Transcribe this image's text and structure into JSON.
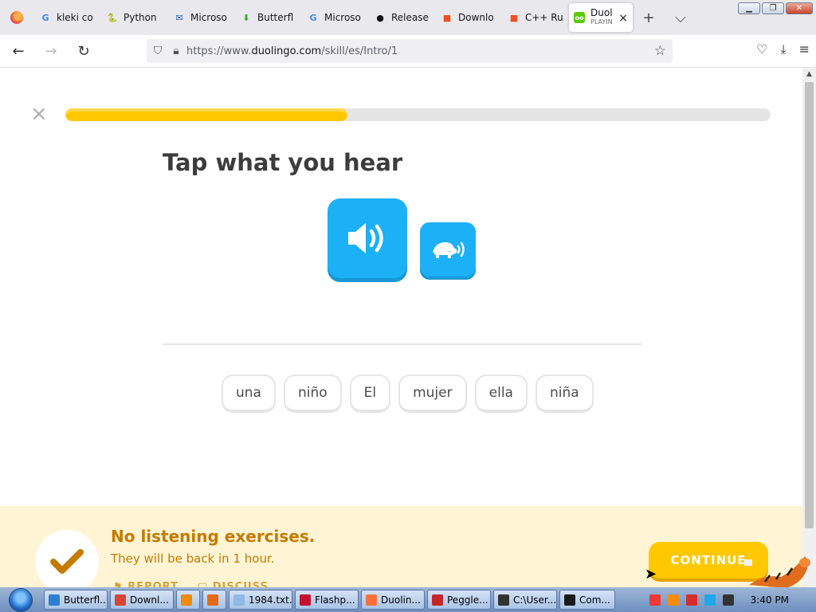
{
  "browser": {
    "tabs": [
      {
        "label": "kleki co",
        "icon": "google-icon",
        "glyph": "G",
        "color": "#4285f4"
      },
      {
        "label": "Python",
        "icon": "python-icon",
        "glyph": "🐍",
        "color": "#3776ab"
      },
      {
        "label": "Microso",
        "icon": "outlook-icon",
        "glyph": "✉",
        "color": "#1b5bb5"
      },
      {
        "label": "Butterfl",
        "icon": "download-icon",
        "glyph": "⬇",
        "color": "#3aa832"
      },
      {
        "label": "Microso",
        "icon": "google-icon",
        "glyph": "G",
        "color": "#4285f4"
      },
      {
        "label": "Release",
        "icon": "github-icon",
        "glyph": "●",
        "color": "#111111"
      },
      {
        "label": "Downlo",
        "icon": "microsoft-icon",
        "glyph": "■",
        "color": "#f25022"
      },
      {
        "label": "C++ Ru",
        "icon": "microsoft-icon",
        "glyph": "■",
        "color": "#f25022"
      }
    ],
    "active_tab": {
      "label": "Duol",
      "sub": "PLAYIN",
      "icon": "duolingo-icon",
      "close": "×"
    },
    "new_tab": "+",
    "tab_list": "⌵",
    "window_buttons": {
      "minimize": "▁",
      "restore": "❐",
      "close": "✕"
    },
    "nav": {
      "back": "←",
      "forward": "→",
      "reload": "↻"
    },
    "url": {
      "prefix": "https://www.",
      "domain": "duolingo.com",
      "path": "/skill/es/Intro/1"
    },
    "bookmark": "☆",
    "right_icons": {
      "pocket": "♡",
      "downloads": "⤓",
      "menu": "≡"
    }
  },
  "lesson": {
    "close": "×",
    "progress_fraction": 0.4,
    "title": "Tap what you hear",
    "words": [
      "una",
      "niño",
      "El",
      "mujer",
      "ella",
      "niña"
    ]
  },
  "feedback": {
    "title": "No listening exercises.",
    "subtitle": "They will be back in 1 hour.",
    "report": "REPORT",
    "discuss": "DISCUSS",
    "continue": "CONTINUE"
  },
  "taskbar": {
    "items": [
      {
        "label": "Butterfl...",
        "icon": "ie-icon",
        "color": "#2d7fd4"
      },
      {
        "label": "Downl...",
        "icon": "chrome-icon",
        "color": "#d94535"
      },
      {
        "label": "",
        "icon": "media-player-icon",
        "color": "#f08a00"
      },
      {
        "label": "",
        "icon": "app-icon",
        "color": "#e36a1c"
      },
      {
        "label": "1984.txt...",
        "icon": "notepad-icon",
        "color": "#8fb9e8"
      },
      {
        "label": "Flashp...",
        "icon": "flashpoint-icon",
        "color": "#c8102e"
      },
      {
        "label": "Duolin...",
        "icon": "firefox-icon",
        "color": "#ff7139"
      },
      {
        "label": "Peggle...",
        "icon": "peggle-icon",
        "color": "#c0282d"
      },
      {
        "label": "C:\\User...",
        "icon": "7zip-icon",
        "color": "#333333"
      },
      {
        "label": "Com...",
        "icon": "cmd-icon",
        "color": "#1a1a1a"
      }
    ],
    "tray_icons": [
      {
        "icon": "vivaldi-icon",
        "color": "#ef3939"
      },
      {
        "icon": "search-icon",
        "color": "#ff8c00"
      },
      {
        "icon": "flag-icon",
        "color": "#d92c2c"
      },
      {
        "icon": "display-icon",
        "color": "#20a7e8"
      },
      {
        "icon": "volume-icon",
        "color": "#333333"
      }
    ],
    "clock": "3:40 PM"
  },
  "colors": {
    "accent_blue": "#1cb0f6",
    "progress_yellow": "#ffc800",
    "feedback_bg": "#fff4d4",
    "feedback_text": "#c57a00"
  }
}
